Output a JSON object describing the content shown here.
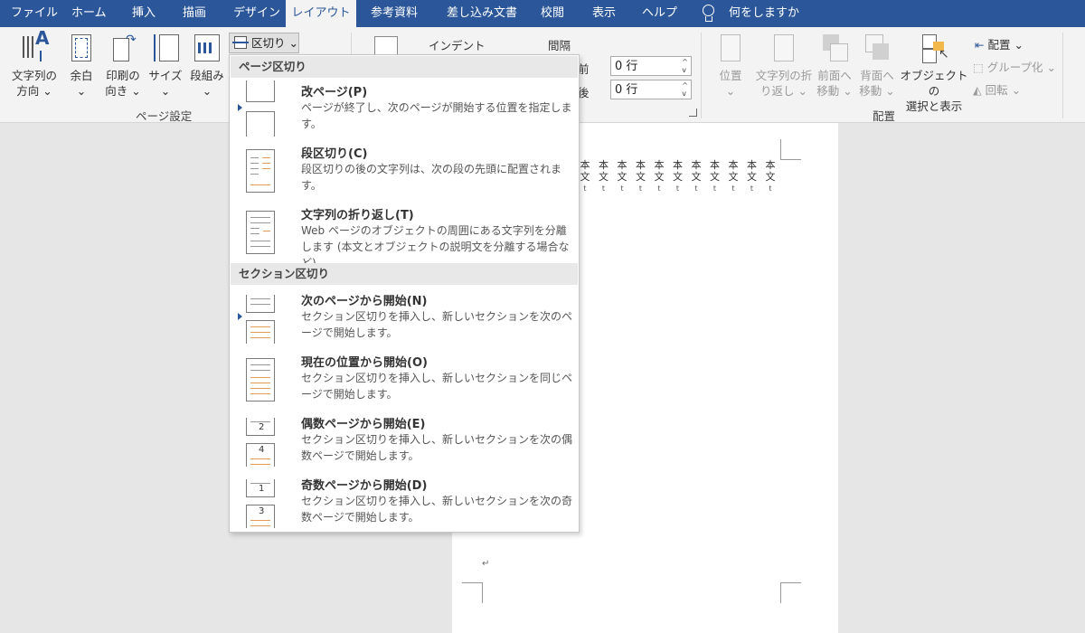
{
  "tabs": [
    {
      "label": "ファイル"
    },
    {
      "label": "ホーム"
    },
    {
      "label": "挿入"
    },
    {
      "label": "描画"
    },
    {
      "label": "デザイン"
    },
    {
      "label": "レイアウト"
    },
    {
      "label": "参考資料"
    },
    {
      "label": "差し込み文書"
    },
    {
      "label": "校閲"
    },
    {
      "label": "表示"
    },
    {
      "label": "ヘルプ"
    }
  ],
  "search": {
    "label": "何をしますか"
  },
  "ribbon": {
    "page_setup": {
      "group_label": "ページ設定",
      "text_direction": {
        "line1": "文字列の",
        "line2": "方向 ⌄"
      },
      "margins": {
        "line1": "余白",
        "line2": "⌄"
      },
      "orientation": {
        "line1": "印刷の",
        "line2": "向き ⌄"
      },
      "size": {
        "line1": "サイズ",
        "line2": "⌄"
      },
      "columns": {
        "line1": "段組み",
        "line2": "⌄"
      },
      "breaks": "区切り ⌄"
    },
    "paragraph": {
      "indent_label": "インデント",
      "spacing_label": "間隔",
      "before_label": "段落前",
      "before_value": "0 行",
      "after_label": "段落後",
      "after_value": "0 行"
    },
    "arrange": {
      "group_label": "配置",
      "position": {
        "line1": "位置",
        "line2": "⌄"
      },
      "wrap_text": {
        "line1": "文字列の折",
        "line2": "り返し ⌄"
      },
      "bring_forward": {
        "line1": "前面へ",
        "line2": "移動 ⌄"
      },
      "send_backward": {
        "line1": "背面へ",
        "line2": "移動 ⌄"
      },
      "selection_pane": {
        "line1": "オブジェクトの",
        "line2": "選択と表示"
      },
      "align": "配置 ⌄",
      "group": "グループ化 ⌄",
      "rotate": "回転 ⌄"
    }
  },
  "dropdown": {
    "page_breaks_header": "ページ区切り",
    "section_breaks_header": "セクション区切り",
    "items": [
      {
        "title": "改ページ(P)",
        "desc": "ページが終了し、次のページが開始する位置を指定します。"
      },
      {
        "title": "段区切り(C)",
        "desc": "段区切りの後の文字列は、次の段の先頭に配置されます。"
      },
      {
        "title": "文字列の折り返し(T)",
        "desc": "Web ページのオブジェクトの周囲にある文字列を分離します (本文とオブジェクトの説明文を分離する場合など)。"
      },
      {
        "title": "次のページから開始(N)",
        "desc": "セクション区切りを挿入し、新しいセクションを次のページで開始します。"
      },
      {
        "title": "現在の位置から開始(O)",
        "desc": "セクション区切りを挿入し、新しいセクションを同じページで開始します。"
      },
      {
        "title": "偶数ページから開始(E)",
        "desc": "セクション区切りを挿入し、新しいセクションを次の偶数ページで開始します。",
        "icon_nums": [
          "2",
          "4"
        ]
      },
      {
        "title": "奇数ページから開始(D)",
        "desc": "セクション区切りを挿入し、新しいセクションを次の奇数ページで開始します。",
        "icon_nums": [
          "1",
          "3"
        ]
      }
    ]
  },
  "document": {
    "body_char": "本",
    "body_char2": "文",
    "ruby_char": "t",
    "column_count": 11,
    "para_mark": "↵"
  },
  "colors": {
    "accent": "#2b579a",
    "orange_line": "#e59a5a"
  }
}
